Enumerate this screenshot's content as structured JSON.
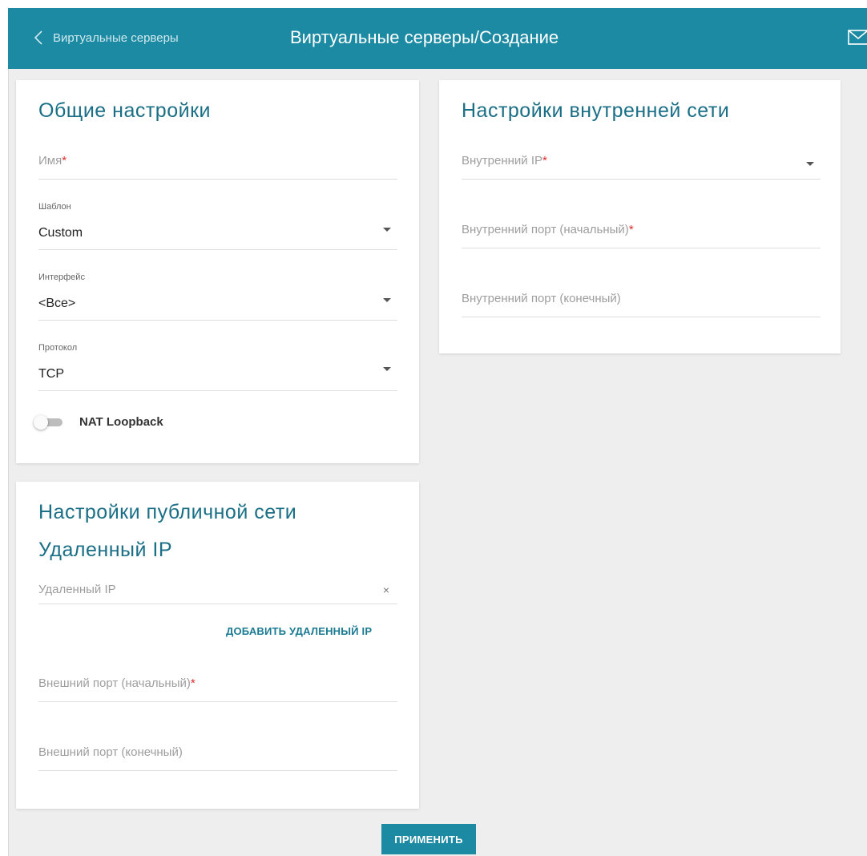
{
  "header": {
    "back_label": "Виртуальные серверы",
    "title": "Виртуальные серверы/Создание",
    "icons": {
      "back": "chevron-left-icon",
      "mail": "mail-icon"
    },
    "color": "#1d8aa3"
  },
  "general": {
    "title": "Общие настройки",
    "name": {
      "placeholder": "Имя",
      "required_mark": "*",
      "value": ""
    },
    "template": {
      "label": "Шаблон",
      "value": "Custom"
    },
    "interface": {
      "label": "Интерфейс",
      "value": "<Все>"
    },
    "protocol": {
      "label": "Протокол",
      "value": "TCP"
    },
    "nat_loopback": {
      "label": "NAT Loopback",
      "enabled": false
    }
  },
  "internal": {
    "title": "Настройки внутренней сети",
    "ip": {
      "placeholder": "Внутренний IP",
      "required_mark": "*"
    },
    "port_start": {
      "placeholder": "Внутренний порт (начальный)",
      "required_mark": "*"
    },
    "port_end": {
      "placeholder": "Внутренний порт (конечный)"
    }
  },
  "public": {
    "title": "Настройки публичной сети",
    "remote_ip_title": "Удаленный IP",
    "remote_ip": {
      "placeholder": "Удаленный IP",
      "clear": "×"
    },
    "add_remote_ip": "ДОБАВИТЬ УДАЛЕННЫЙ IP",
    "ext_port_start": {
      "placeholder": "Внешний порт (начальный)",
      "required_mark": "*"
    },
    "ext_port_end": {
      "placeholder": "Внешний порт (конечный)"
    }
  },
  "actions": {
    "apply": "ПРИМЕНИТЬ"
  }
}
